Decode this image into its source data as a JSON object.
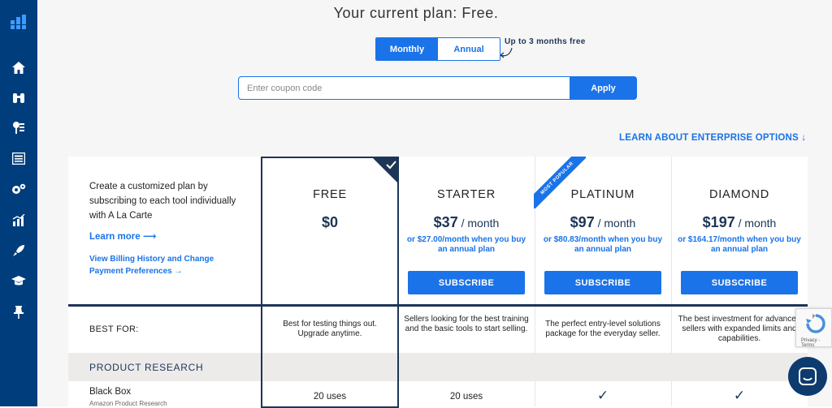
{
  "header": {
    "title": "Your current plan: Free.",
    "billing_toggle": {
      "monthly": "Monthly",
      "annual": "Annual"
    },
    "promo": "Up to 3 months free",
    "coupon_placeholder": "Enter coupon code",
    "apply_label": "Apply",
    "enterprise_link": "LEARN ABOUT ENTERPRISE OPTIONS ↓"
  },
  "intro": {
    "text": "Create a customized plan by subscribing to each tool individually with A La Carte",
    "learn_more": "Learn more ⟶",
    "billing_link": "View Billing History and Change Payment Preferences →"
  },
  "plans": [
    {
      "name": "FREE",
      "price": "$0",
      "per": "",
      "annual": "",
      "subscribe": "",
      "best_for": "Best for testing things out. Upgrade anytime.",
      "black_box": "20 uses",
      "current": true
    },
    {
      "name": "STARTER",
      "price": "$37",
      "per": " / month",
      "annual": "or $27.00/month when you buy an annual plan",
      "subscribe": "SUBSCRIBE",
      "best_for": "Sellers looking for the best training and the basic tools to start selling.",
      "black_box": "20 uses"
    },
    {
      "name": "PLATINUM",
      "price": "$97",
      "per": " / month",
      "annual": "or $80.83/month when you buy an annual plan",
      "subscribe": "SUBSCRIBE",
      "best_for": "The perfect entry-level solutions package for the everyday seller.",
      "black_box": "✓",
      "badge": "MOST POPULAR"
    },
    {
      "name": "DIAMOND",
      "price": "$197",
      "per": " / month",
      "annual": "or $164.17/month when you buy an annual plan",
      "subscribe": "SUBSCRIBE",
      "best_for": "The best investment for advanced sellers with expanded limits and capabilities.",
      "black_box": "✓"
    }
  ],
  "table": {
    "best_for_label": "BEST FOR:",
    "section": "PRODUCT RESEARCH",
    "row_title": "Black Box",
    "row_subtitle": "Amazon Product Research"
  },
  "recaptcha": {
    "text": "Privacy - Terms"
  },
  "sidebar": {
    "icons": [
      "logo-icon",
      "home-icon",
      "binoculars-icon",
      "keyword-icon",
      "listing-icon",
      "gears-icon",
      "chart-icon",
      "rocket-icon",
      "graduation-cap-icon",
      "pin-icon"
    ]
  },
  "colors": {
    "sidebar": "#003d7c",
    "accent": "#1a73e8",
    "navy": "#1d3557"
  }
}
